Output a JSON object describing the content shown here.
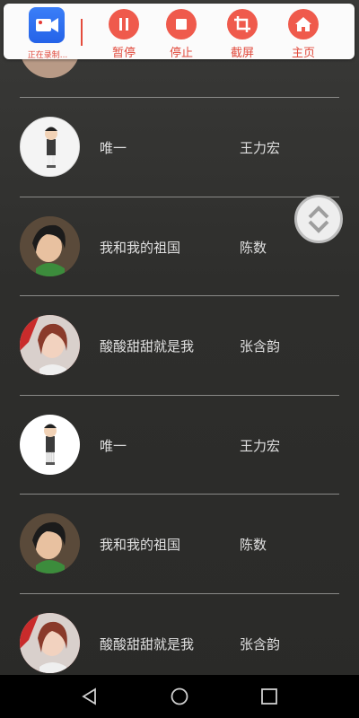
{
  "recorder": {
    "app_caption": "正在录制...",
    "tools": [
      {
        "label": "暂停",
        "icon": "pause-icon"
      },
      {
        "label": "停止",
        "icon": "stop-icon"
      },
      {
        "label": "截屏",
        "icon": "crop-icon"
      },
      {
        "label": "主页",
        "icon": "home-icon"
      }
    ]
  },
  "songs": [
    {
      "title": "唯一",
      "artist": "王力宏"
    },
    {
      "title": "我和我的祖国",
      "artist": "陈数"
    },
    {
      "title": "酸酸甜甜就是我",
      "artist": "张含韵"
    },
    {
      "title": "唯一",
      "artist": "王力宏"
    },
    {
      "title": "我和我的祖国",
      "artist": "陈数"
    },
    {
      "title": "酸酸甜甜就是我",
      "artist": "张含韵"
    }
  ],
  "colors": {
    "accent": "#ef5a4c",
    "app_icon": "#2f6ef0"
  }
}
